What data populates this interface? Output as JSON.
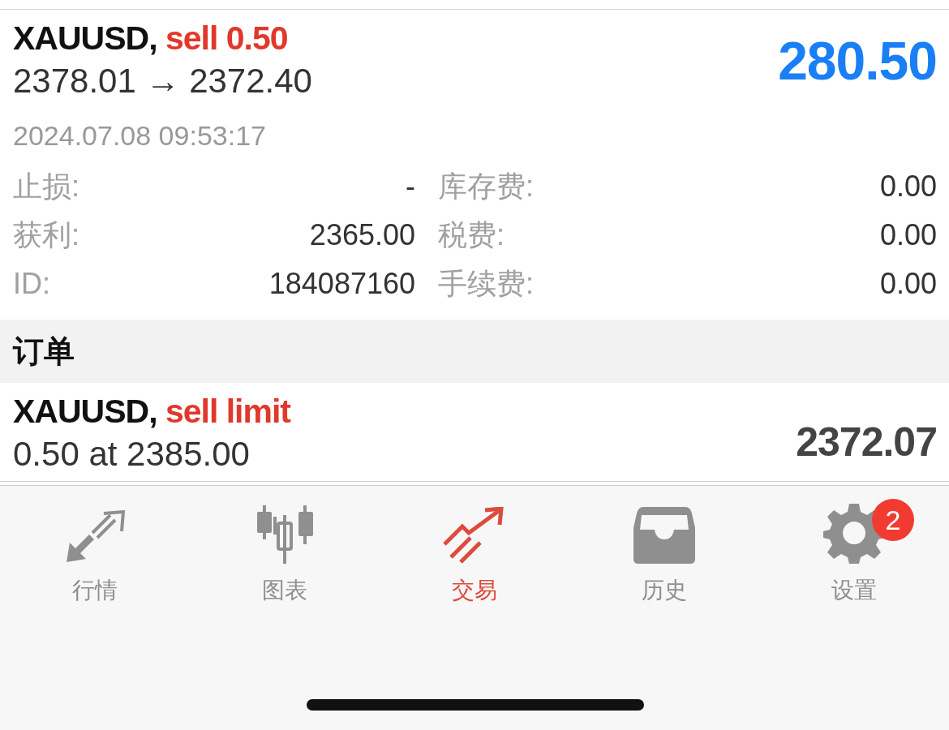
{
  "position": {
    "symbol": "XAUUSD,",
    "trade": "sell 0.50",
    "prices": "2378.01 → 2372.40",
    "profit": "280.50",
    "time": "2024.07.08 09:53:17",
    "details": [
      {
        "left_label": "止损:",
        "left_value": "-",
        "right_label": "库存费:",
        "right_value": "0.00"
      },
      {
        "left_label": "获利:",
        "left_value": "2365.00",
        "right_label": "税费:",
        "right_value": "0.00"
      },
      {
        "left_label": "ID:",
        "left_value": "184087160",
        "right_label": "手续费:",
        "right_value": "0.00"
      }
    ]
  },
  "orders_header": "订单",
  "order": {
    "symbol": "XAUUSD,",
    "trade": "sell limit",
    "details": "0.50 at 2385.00",
    "price": "2372.07"
  },
  "tabs": [
    {
      "kind": "quotes",
      "label": "行情",
      "selected": false
    },
    {
      "kind": "chart",
      "label": "图表",
      "selected": false
    },
    {
      "kind": "trade",
      "label": "交易",
      "selected": true
    },
    {
      "kind": "history",
      "label": "历史",
      "selected": false
    },
    {
      "kind": "settings",
      "label": "设置",
      "selected": false,
      "badge": "2"
    }
  ]
}
